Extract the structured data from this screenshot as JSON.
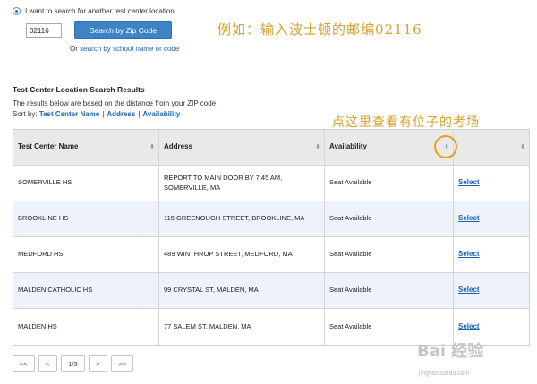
{
  "search": {
    "radio_label": "I want to search for another test center location",
    "zip_value": "02116",
    "button_label": "Search by Zip Code",
    "or_text": "Or",
    "alt_link": "search by school name or code"
  },
  "annotations": {
    "top": "例如：输入波士顿的邮编02116",
    "middle": "点这里查看有位子的考场",
    "accent_color": "#d6a22a"
  },
  "results": {
    "title": "Test Center Location Search Results",
    "description": "The results below are based on the distance from your ZIP code.",
    "sort_by": "Sort by:",
    "sort_options": [
      "Test Center Name",
      "Address",
      "Availability"
    ],
    "separator": "|"
  },
  "table": {
    "columns": [
      "Test Center Name",
      "Address",
      "Availability",
      ""
    ],
    "rows": [
      {
        "name": "SOMERVILLE HS",
        "address": "REPORT TO MAIN DOOR BY 7:45 AM, SOMERVILLE, MA",
        "availability": "Seat Available",
        "action": "Select"
      },
      {
        "name": "BROOKLINE HS",
        "address": "115 GREENOUGH STREET, BROOKLINE, MA",
        "availability": "Seat Available",
        "action": "Select"
      },
      {
        "name": "MEDFORD HS",
        "address": "489 WINTHROP STREET, MEDFORD, MA",
        "availability": "Seat Available",
        "action": "Select"
      },
      {
        "name": "MALDEN CATHOLIC HS",
        "address": "99 CRYSTAL ST, MALDEN, MA",
        "availability": "Seat Available",
        "action": "Select"
      },
      {
        "name": "MALDEN HS",
        "address": "77 SALEM ST, MALDEN, MA",
        "availability": "Seat Available",
        "action": "Select"
      }
    ],
    "sort_icon": "sort-arrows-icon"
  },
  "pagination": {
    "first": "<<",
    "prev": "<",
    "current": "1/3",
    "next": ">",
    "last": ">>"
  },
  "watermark": {
    "logo": "Bai 经验",
    "url": "jingyan.baidu.com"
  },
  "colors": {
    "primary_button": "#3d84c6",
    "link": "#1a63b0",
    "header_bg": "#e9e9e9",
    "alt_row_bg": "#eef2fa",
    "highlight_ring": "#e6a21c"
  }
}
